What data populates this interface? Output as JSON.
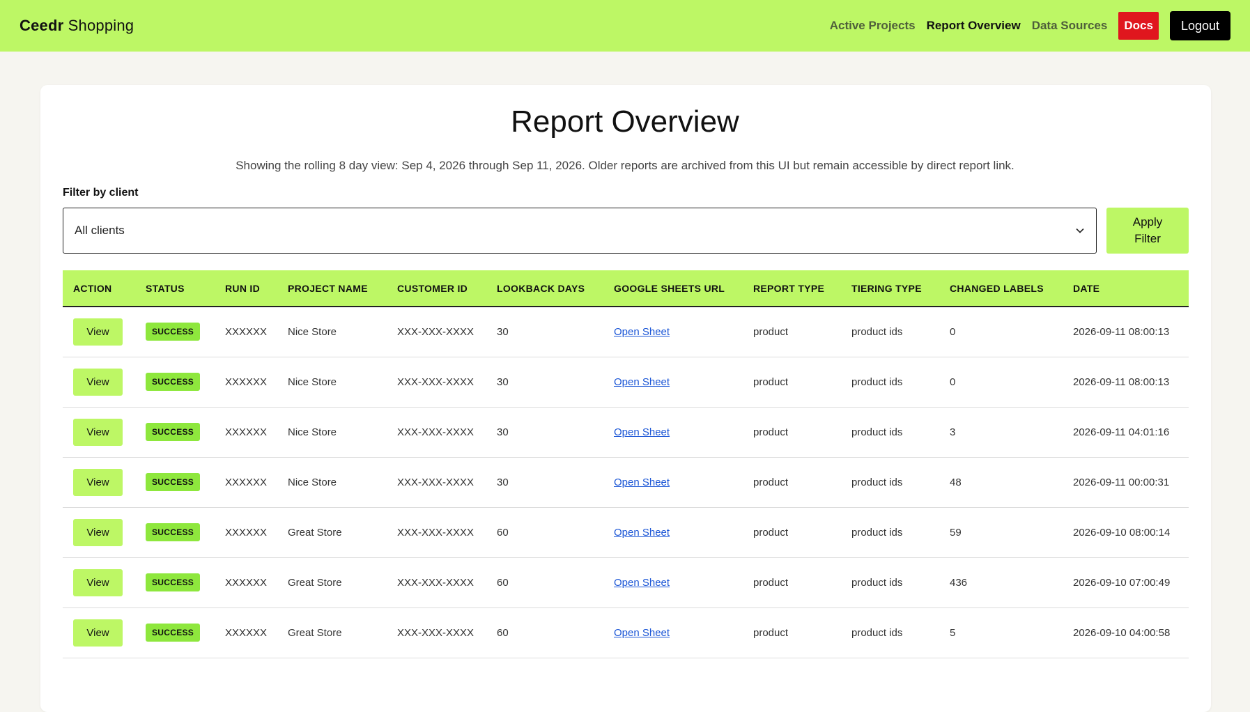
{
  "brand": {
    "strong": "Ceedr",
    "light": "Shopping"
  },
  "nav": {
    "links": [
      {
        "label": "Active Projects"
      },
      {
        "label": "Report Overview"
      },
      {
        "label": "Data Sources"
      }
    ],
    "docs_label": "Docs",
    "logout_label": "Logout"
  },
  "page": {
    "title": "Report Overview",
    "subtitle": "Showing the rolling 8 day view: Sep 4, 2026 through Sep 11, 2026. Older reports are archived from this UI but remain accessible by direct report link."
  },
  "filter": {
    "label": "Filter by client",
    "selected": "All clients",
    "apply_label_line1": "Apply",
    "apply_label_line2": "Filter"
  },
  "table": {
    "headers": [
      "ACTION",
      "STATUS",
      "RUN ID",
      "PROJECT NAME",
      "CUSTOMER ID",
      "LOOKBACK DAYS",
      "GOOGLE SHEETS URL",
      "REPORT TYPE",
      "TIERING TYPE",
      "CHANGED LABELS",
      "DATE"
    ],
    "rows": [
      {
        "action": "View",
        "status": "SUCCESS",
        "run_id": "XXXXXX",
        "project": "Nice Store",
        "customer_id": "XXX-XXX-XXXX",
        "lookback": "30",
        "sheet": "Open Sheet",
        "report_type": "product",
        "tiering": "product ids",
        "changed": "0",
        "date": "2026-09-11 08:00:13"
      },
      {
        "action": "View",
        "status": "SUCCESS",
        "run_id": "XXXXXX",
        "project": "Nice Store",
        "customer_id": "XXX-XXX-XXXX",
        "lookback": "30",
        "sheet": "Open Sheet",
        "report_type": "product",
        "tiering": "product ids",
        "changed": "0",
        "date": "2026-09-11 08:00:13"
      },
      {
        "action": "View",
        "status": "SUCCESS",
        "run_id": "XXXXXX",
        "project": "Nice Store",
        "customer_id": "XXX-XXX-XXXX",
        "lookback": "30",
        "sheet": "Open Sheet",
        "report_type": "product",
        "tiering": "product ids",
        "changed": "3",
        "date": "2026-09-11 04:01:16"
      },
      {
        "action": "View",
        "status": "SUCCESS",
        "run_id": "XXXXXX",
        "project": "Nice Store",
        "customer_id": "XXX-XXX-XXXX",
        "lookback": "30",
        "sheet": "Open Sheet",
        "report_type": "product",
        "tiering": "product ids",
        "changed": "48",
        "date": "2026-09-11 00:00:31"
      },
      {
        "action": "View",
        "status": "SUCCESS",
        "run_id": "XXXXXX",
        "project": "Great Store",
        "customer_id": "XXX-XXX-XXXX",
        "lookback": "60",
        "sheet": "Open Sheet",
        "report_type": "product",
        "tiering": "product ids",
        "changed": "59",
        "date": "2026-09-10 08:00:14"
      },
      {
        "action": "View",
        "status": "SUCCESS",
        "run_id": "XXXXXX",
        "project": "Great Store",
        "customer_id": "XXX-XXX-XXXX",
        "lookback": "60",
        "sheet": "Open Sheet",
        "report_type": "product",
        "tiering": "product ids",
        "changed": "436",
        "date": "2026-09-10 07:00:49"
      },
      {
        "action": "View",
        "status": "SUCCESS",
        "run_id": "XXXXXX",
        "project": "Great Store",
        "customer_id": "XXX-XXX-XXXX",
        "lookback": "60",
        "sheet": "Open Sheet",
        "report_type": "product",
        "tiering": "product ids",
        "changed": "5",
        "date": "2026-09-10 04:00:58"
      }
    ]
  },
  "colors": {
    "accent": "#bdf765",
    "success_badge": "#8ee73d",
    "docs_red": "#e0161e",
    "link_blue": "#1a55d6",
    "page_bg": "#f6f5f0"
  },
  "icons": {
    "select_chevron": "chevron-down-icon"
  }
}
